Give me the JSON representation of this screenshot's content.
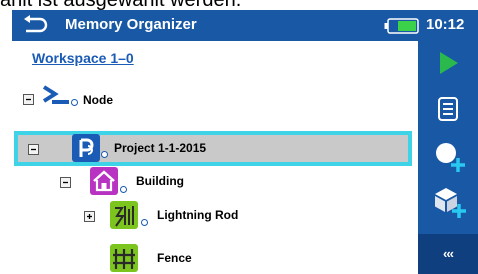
{
  "caption": "ählt ist ausgewählt werden.",
  "header": {
    "title": "Memory Organizer",
    "time": "10:12"
  },
  "workspace": {
    "title": "Workspace 1–0"
  },
  "tree": [
    {
      "label": "Node",
      "icon": "node-icon",
      "expander": "minus"
    },
    {
      "label": "Project 1-1-2015",
      "icon": "project-icon",
      "expander": "minus",
      "selected": true
    },
    {
      "label": "Building",
      "icon": "building-icon",
      "expander": "minus"
    },
    {
      "label": "Lightning Rod",
      "icon": "lightning-rod-icon",
      "expander": "plus"
    },
    {
      "label": "Fence",
      "icon": "fence-icon",
      "expander": "none"
    }
  ],
  "sidebar": {
    "buttons": [
      "start-icon",
      "list-icon",
      "add-measurement-icon",
      "add-structure-icon"
    ],
    "more_label": "‹‹‹"
  },
  "colors": {
    "header_bg": "#1858a5",
    "selection_border": "#3fd3e8",
    "selection_bg": "#c9c9c9",
    "play_green": "#2ab94d",
    "plus_cyan": "#28c8f0"
  }
}
